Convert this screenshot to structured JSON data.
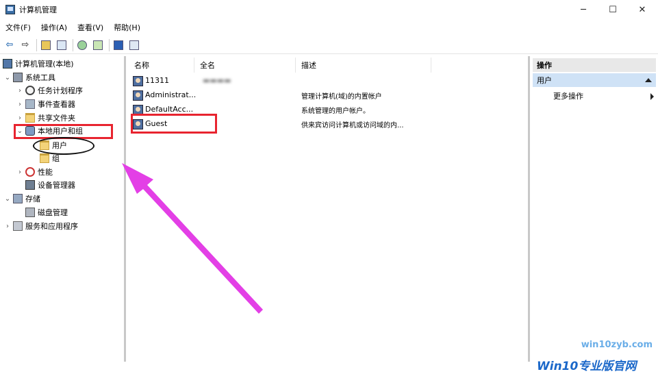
{
  "window": {
    "title": "计算机管理",
    "minimize": "─",
    "maximize": "☐",
    "close": "✕"
  },
  "menu": [
    "文件(F)",
    "操作(A)",
    "查看(V)",
    "帮助(H)"
  ],
  "toolbar": {
    "back": "⇦",
    "forward": "⇨"
  },
  "tree": {
    "root": "计算机管理(本地)",
    "system_tools": "系统工具",
    "task_scheduler": "任务计划程序",
    "event_viewer": "事件查看器",
    "shared_folders": "共享文件夹",
    "local_users_groups": "本地用户和组",
    "users": "用户",
    "groups": "组",
    "performance": "性能",
    "device_manager": "设备管理器",
    "storage": "存储",
    "disk_management": "磁盘管理",
    "services_apps": "服务和应用程序"
  },
  "list": {
    "columns": [
      "名称",
      "全名",
      "描述"
    ],
    "rows": [
      {
        "name": "11311",
        "full": "",
        "desc": ""
      },
      {
        "name": "Administrat...",
        "full": "",
        "desc": "管理计算机(域)的内置帐户"
      },
      {
        "name": "DefaultAcc...",
        "full": "",
        "desc": "系统管理的用户帐户。"
      },
      {
        "name": "Guest",
        "full": "",
        "desc": "供来宾访问计算机或访问域的内..."
      }
    ]
  },
  "actions": {
    "header": "操作",
    "section": "用户",
    "more": "更多操作"
  },
  "watermark": {
    "url": "win10zyb.com",
    "logo": "Win10专业版官网"
  },
  "colors": {
    "annotation_red": "#e8242f",
    "arrow_magenta": "#e33fe6",
    "selection": "#cfe2f6"
  }
}
